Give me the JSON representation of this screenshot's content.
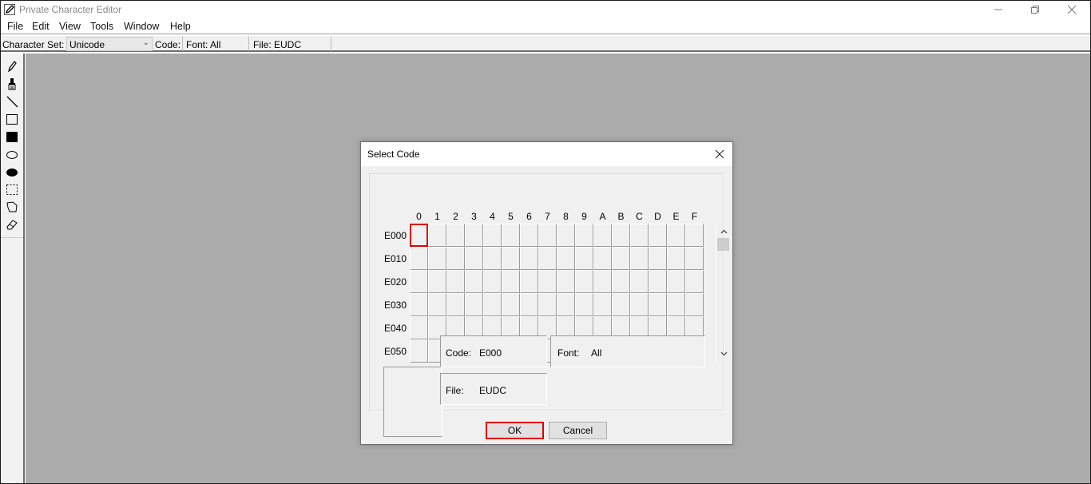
{
  "window": {
    "title": "Private Character Editor",
    "controls": {
      "minimize": "minimize",
      "restore": "restore",
      "close": "close"
    }
  },
  "menu": [
    "File",
    "Edit",
    "View",
    "Tools",
    "Window",
    "Help"
  ],
  "toolbar": {
    "charset_label": "Character Set:",
    "charset_value": "Unicode",
    "code_label": "Code:",
    "font_label": "Font: All",
    "file_label": "File: EUDC"
  },
  "tools": [
    "pencil",
    "brush",
    "line",
    "hollow-rectangle",
    "filled-rectangle",
    "hollow-ellipse",
    "filled-ellipse",
    "rectangular-selection",
    "freeform-selection",
    "eraser"
  ],
  "dialog": {
    "title": "Select Code",
    "columns": [
      "0",
      "1",
      "2",
      "3",
      "4",
      "5",
      "6",
      "7",
      "8",
      "9",
      "A",
      "B",
      "C",
      "D",
      "E",
      "F"
    ],
    "rows": [
      "E000",
      "E010",
      "E020",
      "E030",
      "E040",
      "E050"
    ],
    "selected_cell": {
      "row": "E000",
      "column": "0"
    },
    "code_label": "Code:",
    "code_value": "E000",
    "font_label": "Font:",
    "font_value": "All",
    "file_label": "File:",
    "file_value": "EUDC",
    "ok_label": "OK",
    "cancel_label": "Cancel"
  },
  "colors": {
    "workspace": "#ababab",
    "selection": "#e00000",
    "dialog_bg": "#f0f0f0"
  }
}
